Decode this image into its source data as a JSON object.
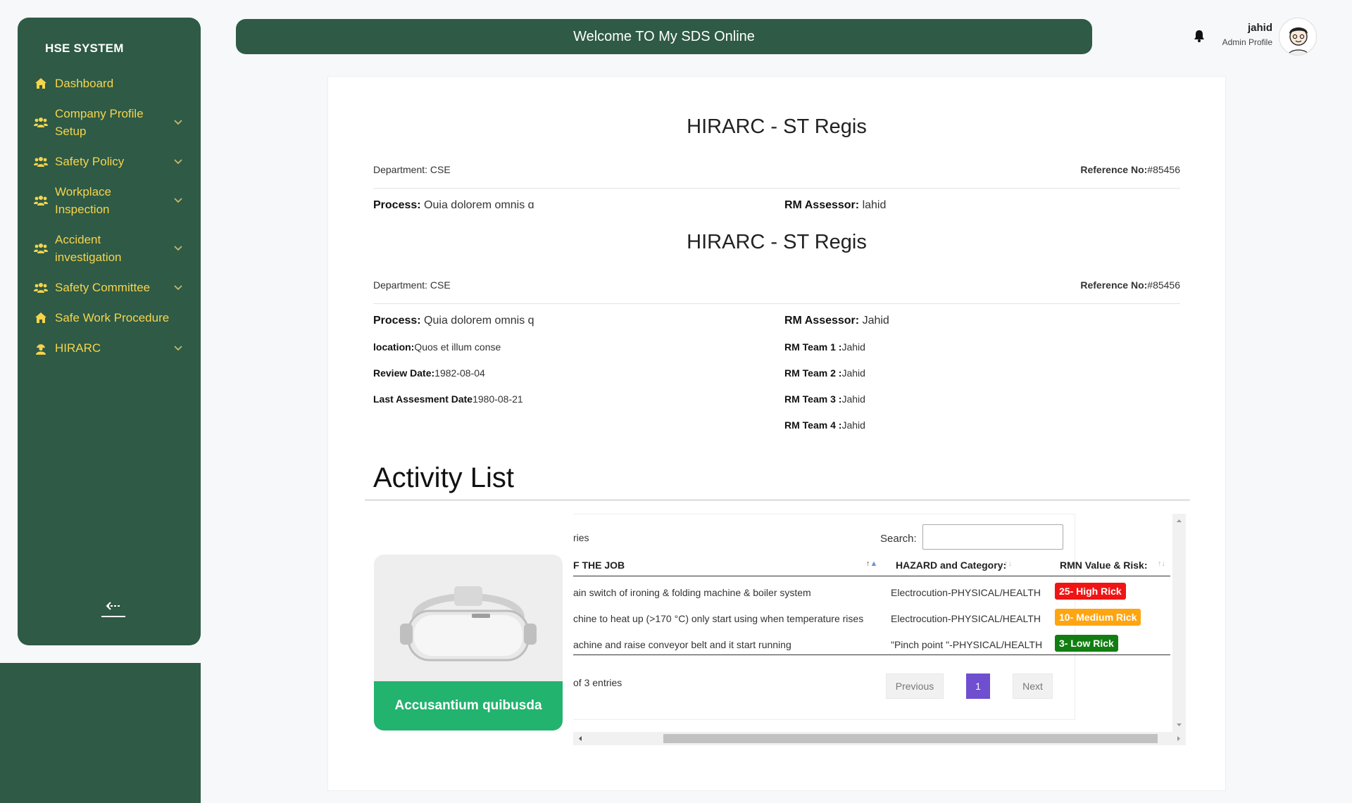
{
  "sidebar": {
    "brand": "HSE SYSTEM",
    "items": [
      {
        "label": "Dashboard"
      },
      {
        "label": "Company Profile Setup"
      },
      {
        "label": "Safety Policy"
      },
      {
        "label": "Workplace Inspection"
      },
      {
        "label": "Accident investigation"
      },
      {
        "label": "Safety Committee"
      },
      {
        "label": "Safe Work Procedure"
      },
      {
        "label": "HIRARC"
      }
    ]
  },
  "header": {
    "title": "Welcome TO My SDS Online",
    "user_name": "jahid",
    "user_role": "Admin Profile"
  },
  "report1": {
    "title": "HIRARC - ST Regis",
    "department": "Department: CSE",
    "reference_label": "Reference No:",
    "reference_value": "#85456",
    "process_label": "Process:",
    "process_value": "Ouia dolorem omnis ɑ",
    "assessor_label": "RM Assessor:",
    "assessor_value": "lahid"
  },
  "report2": {
    "title": "HIRARC - ST Regis",
    "department": "Department: CSE",
    "reference_label": "Reference No:",
    "reference_value": "#85456",
    "process_label": "Process:",
    "process_value": "Quia dolorem omnis q",
    "assessor_label": "RM Assessor:",
    "assessor_value": "Jahid",
    "location_label": "location:",
    "location_value": "Quos et illum conse",
    "review_label": "Review Date:",
    "review_value": "1982-08-04",
    "last_label": "Last Assesment Date",
    "last_value": "1980-08-21",
    "team1_label": "RM Team 1 :",
    "team1_value": "Jahid",
    "team2_label": "RM Team 2 :",
    "team2_value": "Jahid",
    "team3_label": "RM Team 3 :",
    "team3_value": "Jahid",
    "team4_label": "RM Team 4 :",
    "team4_value": "Jahid"
  },
  "activity": {
    "title": "Activity List",
    "product_label": "Accusantium quibusda"
  },
  "table": {
    "entries_text": "ries",
    "search_label": "Search:",
    "columns": [
      "F THE JOB",
      "HAZARD and Category:",
      "RMN Value & Risk:"
    ],
    "rows": [
      {
        "job": "ain switch of ironing & folding machine & boiler system",
        "hazard": "Electrocution-PHYSICAL/HEALTH",
        "risk": "25- High Rick"
      },
      {
        "job": "chine to heat up (>170 °C) only start using when temperature rises",
        "hazard": "Electrocution-PHYSICAL/HEALTH",
        "risk": "10- Medium Rick"
      },
      {
        "job": "achine and raise conveyor belt and it start running",
        "hazard": "\"Pinch point \"-PHYSICAL/HEALTH",
        "risk": "3- Low Rick"
      }
    ],
    "info": "of 3 entries",
    "prev": "Previous",
    "page": "1",
    "next": "Next"
  },
  "colors": {
    "sidebar": "#2e5a46",
    "nav_text": "#f6d44c",
    "high": "#f01515",
    "medium": "#ffa511",
    "low": "#127e12",
    "product_label": "#22b36e",
    "page_active": "#6f4ecf"
  }
}
